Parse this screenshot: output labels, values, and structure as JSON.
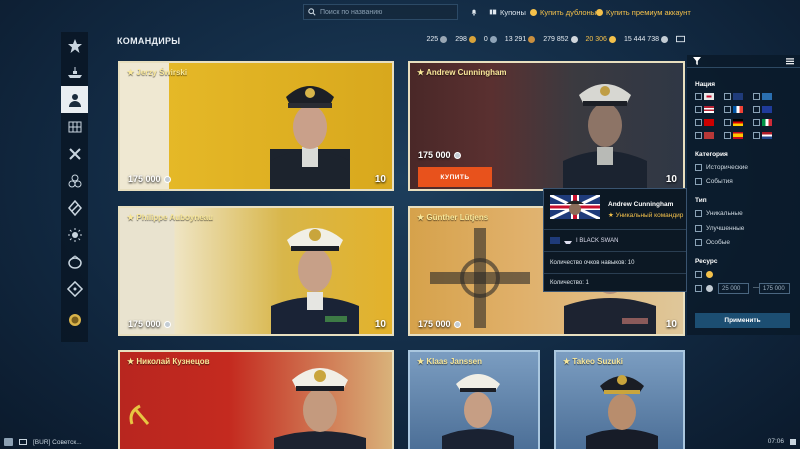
{
  "topbar": {
    "search_placeholder": "Поиск по названию",
    "coupons": "Купоны",
    "buy_doubloons": "Купить дублоны",
    "buy_premium": "Купить премиум аккаунт"
  },
  "header": {
    "title": "КОМАНДИРЫ",
    "currencies": [
      "225",
      "298",
      "0",
      "13 291",
      "279 852",
      "20 306",
      "15 444 738"
    ]
  },
  "nav": {
    "items": [
      "star-icon",
      "ship-icon",
      "commander-icon",
      "dockyard-icon",
      "tools-icon",
      "flags-icon",
      "signals-icon",
      "sun-icon",
      "container-icon",
      "arsenal-icon",
      "emblem-icon"
    ]
  },
  "cards": [
    {
      "name": "★ Jerzy Świrski",
      "price": "175 000",
      "level": "10"
    },
    {
      "name": "★ Andrew Cunningham",
      "price": "175 000",
      "level": "10",
      "buy": "КУПИТЬ"
    },
    {
      "name": "★ Philippe Auboyneau",
      "price": "175 000",
      "level": "10"
    },
    {
      "name": "★ Günther Lütjens",
      "price": "175 000",
      "level": "10"
    },
    {
      "name": "★ Николай Кузнецов"
    },
    {
      "name": "★ Klaas Janssen"
    },
    {
      "name": "★ Takeo Suzuki"
    }
  ],
  "tooltip": {
    "name": "Andrew Cunningham",
    "type": "★ Уникальный командир",
    "ship": "I BLACK SWAN",
    "skill_points": "Количество очков навыков: 10",
    "quantity": "Количество: 1"
  },
  "filters": {
    "nation_label": "Нация",
    "category_label": "Категория",
    "categories": [
      "Исторические",
      "События"
    ],
    "type_label": "Тип",
    "types": [
      "Уникальные",
      "Улучшенные",
      "Особые"
    ],
    "resource_label": "Ресурс",
    "range_min": "25 000",
    "range_dash": "—",
    "range_max": "175 000",
    "apply": "Применить"
  },
  "bottom": {
    "chat": "[BUR] Советск...",
    "time": "07:06"
  },
  "colors": {
    "accent_orange": "#e8521c",
    "gold_text": "#f4c14b",
    "name_yellow": "#f9e89a"
  }
}
